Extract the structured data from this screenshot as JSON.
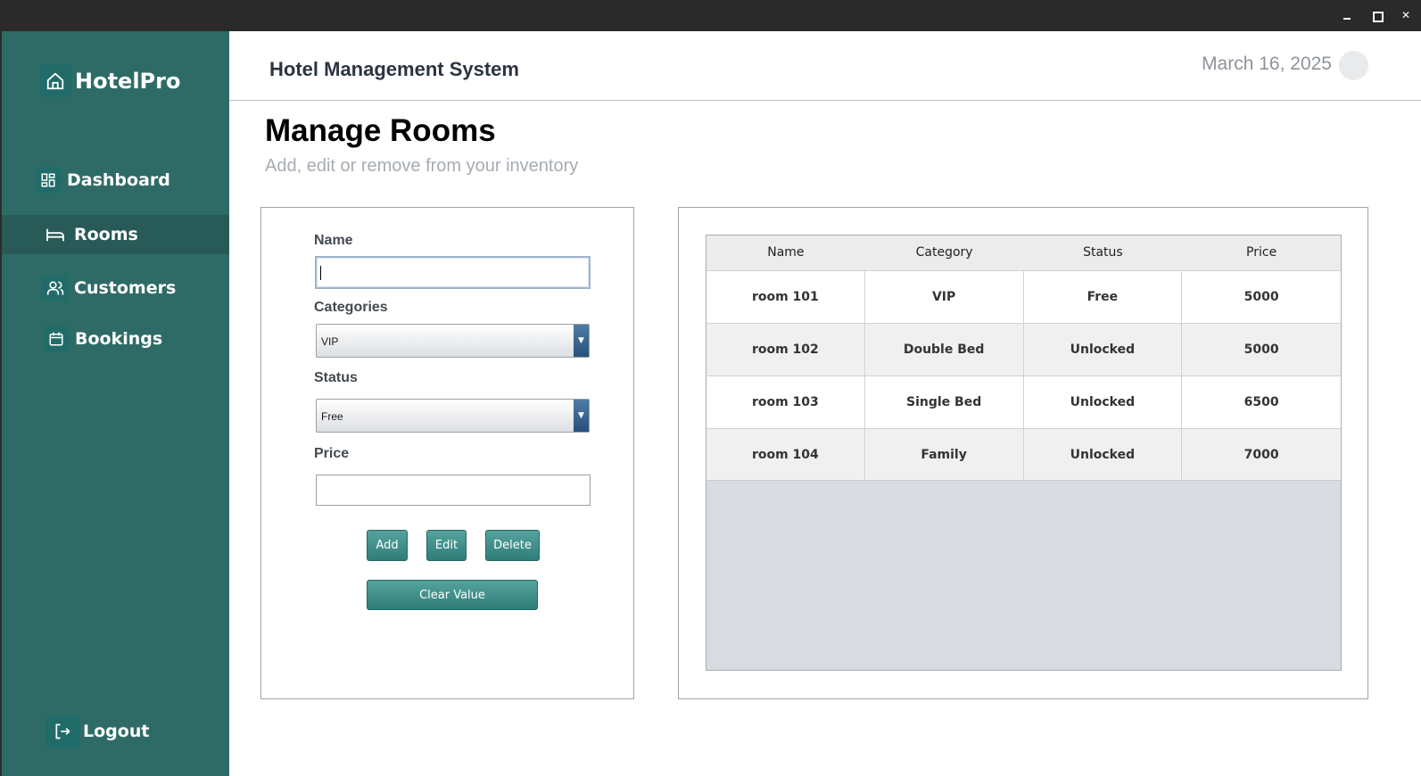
{
  "window": {
    "minimize_label": "–",
    "maximize_label": "□",
    "close_label": "✕"
  },
  "sidebar": {
    "brand": "HotelPro",
    "items": [
      {
        "label": "Dashboard",
        "icon": "dashboard-icon"
      },
      {
        "label": "Rooms",
        "icon": "bed-icon",
        "active": true
      },
      {
        "label": "Customers",
        "icon": "users-icon"
      },
      {
        "label": "Bookings",
        "icon": "calendar-icon"
      }
    ],
    "logout": "Logout"
  },
  "header": {
    "title": "Hotel Management System",
    "date": "March 16, 2025"
  },
  "page": {
    "title": "Manage Rooms",
    "subtitle": "Add, edit or remove from your inventory"
  },
  "form": {
    "name_label": "Name",
    "name_value": "",
    "categories_label": "Categories",
    "categories_value": "VIP",
    "status_label": "Status",
    "status_value": "Free",
    "price_label": "Price",
    "price_value": "",
    "add": "Add",
    "edit": "Edit",
    "delete": "Delete",
    "clear": "Clear Value"
  },
  "table": {
    "columns": [
      "Name",
      "Category",
      "Status",
      "Price"
    ],
    "rows": [
      [
        "room 101",
        "VIP",
        "Free",
        "5000"
      ],
      [
        "room 102",
        "Double Bed",
        "Unlocked",
        "5000"
      ],
      [
        "room 103",
        "Single Bed",
        "Unlocked",
        "6500"
      ],
      [
        "room 104",
        "Family",
        "Unlocked",
        "7000"
      ]
    ]
  },
  "colors": {
    "sidebar": "#2f6b66",
    "sidebar_active": "#285a58",
    "accent": "#3a8a84"
  }
}
